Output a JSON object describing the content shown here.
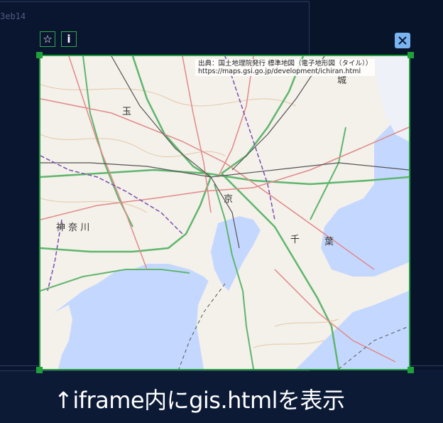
{
  "background_panel": {
    "label": "3eb14"
  },
  "toolbar": {
    "favorite_icon": "star-outline-icon",
    "info_icon": "info-icon",
    "info_label": "i",
    "close_icon": "close-x-icon"
  },
  "map": {
    "attribution_line1": "出典：国土地理院発行 標準地図（電子地形図（タイル））",
    "attribution_line2": "https://maps.gsi.go.jp/development/ichiran.html",
    "place_labels": {
      "saitama": "玉",
      "tokyo": "京",
      "kanagawa": "神 奈 川",
      "chiba_1": "千",
      "chiba_2": "葉",
      "ibaraki": "城"
    },
    "colors": {
      "sea": "#c4d8ff",
      "land": "#f4f0ea",
      "frame": "#1fa03a"
    }
  },
  "caption": {
    "text": "↑iframe内にgis.htmlを表示"
  }
}
